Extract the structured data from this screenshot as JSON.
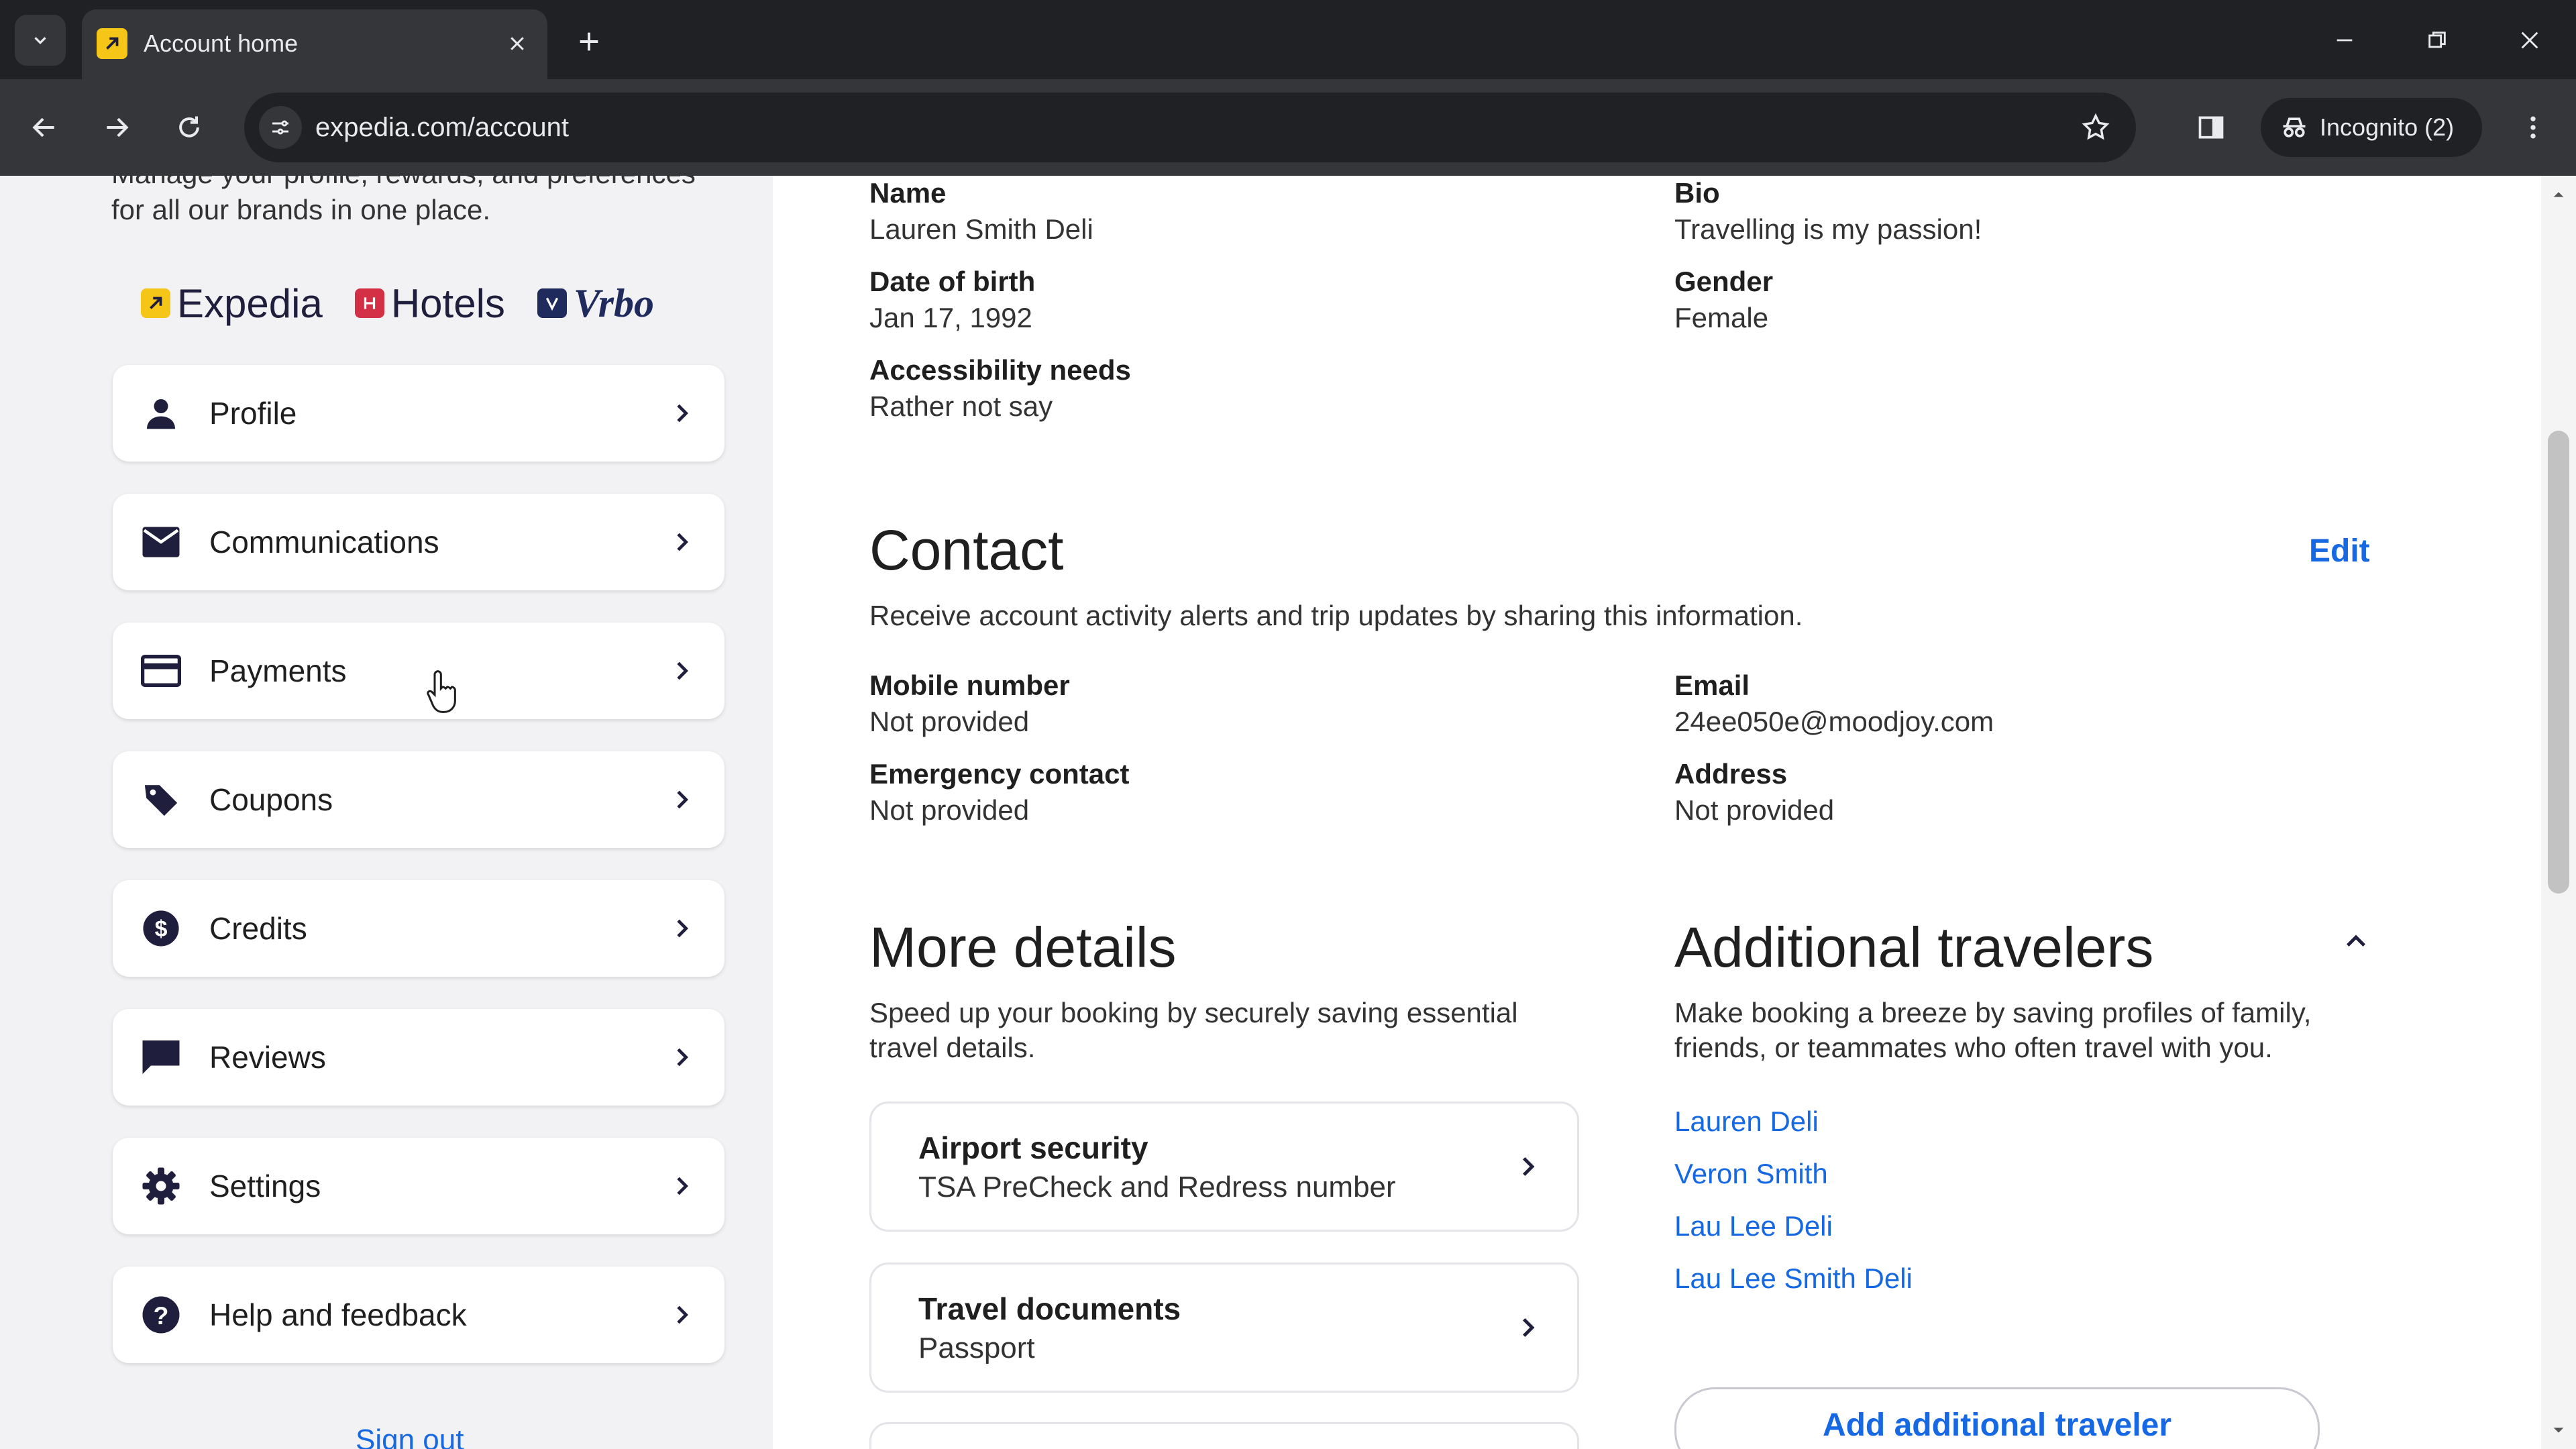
{
  "browser": {
    "tab_title": "Account home",
    "url": "expedia.com/account",
    "incognito_label": "Incognito (2)"
  },
  "sidebar": {
    "intro": "Manage your profile, rewards, and preferences for all our brands in one place.",
    "brands": [
      "Expedia",
      "Hotels",
      "Vrbo"
    ],
    "items": [
      {
        "label": "Profile",
        "icon": "person-icon"
      },
      {
        "label": "Communications",
        "icon": "envelope-icon"
      },
      {
        "label": "Payments",
        "icon": "credit-card-icon"
      },
      {
        "label": "Coupons",
        "icon": "tag-icon"
      },
      {
        "label": "Credits",
        "icon": "dollar-coin-icon"
      },
      {
        "label": "Reviews",
        "icon": "speech-bubble-icon"
      },
      {
        "label": "Settings",
        "icon": "gear-icon"
      },
      {
        "label": "Help and feedback",
        "icon": "question-icon"
      }
    ],
    "sign_out": "Sign out"
  },
  "basic": {
    "name_label": "Name",
    "name_value": "Lauren Smith Deli",
    "dob_label": "Date of birth",
    "dob_value": "Jan 17, 1992",
    "access_label": "Accessibility needs",
    "access_value": "Rather not say",
    "bio_label": "Bio",
    "bio_value": "Travelling is my passion!",
    "gender_label": "Gender",
    "gender_value": "Female"
  },
  "contact": {
    "title": "Contact",
    "edit": "Edit",
    "description": "Receive account activity alerts and trip updates by sharing this information.",
    "mobile_label": "Mobile number",
    "mobile_value": "Not provided",
    "emergency_label": "Emergency contact",
    "emergency_value": "Not provided",
    "email_label": "Email",
    "email_value": "24ee050e@moodjoy.com",
    "address_label": "Address",
    "address_value": "Not provided"
  },
  "more_details": {
    "title": "More details",
    "description": "Speed up your booking by securely saving essential travel details.",
    "cards": [
      {
        "title": "Airport security",
        "subtitle": "TSA PreCheck and Redress number"
      },
      {
        "title": "Travel documents",
        "subtitle": "Passport"
      }
    ]
  },
  "additional_travelers": {
    "title": "Additional travelers",
    "description": "Make booking a breeze by saving profiles of family, friends, or teammates who often travel with you.",
    "travelers": [
      "Lauren Deli",
      "Veron Smith",
      "Lau Lee Deli",
      "Lau Lee Smith Deli"
    ],
    "add_button": "Add additional traveler"
  },
  "colors": {
    "link": "#1668e3",
    "sidebar_bg": "#f2f2f4",
    "chrome_dark": "#202124"
  }
}
